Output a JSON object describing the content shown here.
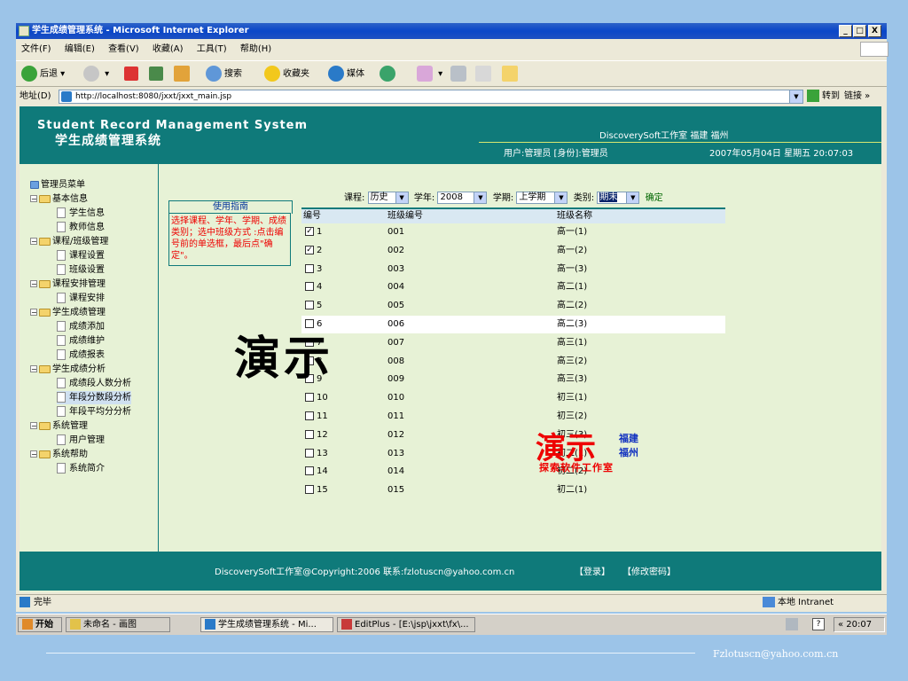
{
  "window": {
    "title": "学生成绩管理系统 - Microsoft Internet Explorer",
    "buttons": {
      "min": "_",
      "max": "□",
      "close": "X"
    }
  },
  "menu": [
    "文件(F)",
    "编辑(E)",
    "查看(V)",
    "收藏(A)",
    "工具(T)",
    "帮助(H)"
  ],
  "toolbar": {
    "back": "后退",
    "search": "搜索",
    "favorites": "收藏夹",
    "media": "媒体"
  },
  "address": {
    "label": "地址(D)",
    "url": "http://localhost:8080/jxxt/jxxt_main.jsp",
    "go": "转到",
    "links": "链接"
  },
  "header": {
    "title_en": "Student Record Management System",
    "title_cn": "学生成绩管理系统",
    "studio": "DiscoverySoft工作室 福建 福州",
    "user": "用户:管理员 [身份]:管理员",
    "datetime": "2007年05月04日 星期五 20:07:03"
  },
  "sidebar": {
    "root": "管理员菜单",
    "items": [
      {
        "label": "基本信息",
        "type": "folder"
      },
      {
        "label": "学生信息",
        "type": "doc"
      },
      {
        "label": "教师信息",
        "type": "doc"
      },
      {
        "label": "课程/班级管理",
        "type": "folder"
      },
      {
        "label": "课程设置",
        "type": "doc"
      },
      {
        "label": "班级设置",
        "type": "doc"
      },
      {
        "label": "课程安排管理",
        "type": "folder"
      },
      {
        "label": "课程安排",
        "type": "doc"
      },
      {
        "label": "学生成绩管理",
        "type": "folder"
      },
      {
        "label": "成绩添加",
        "type": "doc"
      },
      {
        "label": "成绩维护",
        "type": "doc"
      },
      {
        "label": "成绩报表",
        "type": "doc"
      },
      {
        "label": "学生成绩分析",
        "type": "folder"
      },
      {
        "label": "成绩段人数分析",
        "type": "doc"
      },
      {
        "label": "年段分数段分析",
        "type": "doc"
      },
      {
        "label": "年段平均分分析",
        "type": "doc"
      },
      {
        "label": "系统管理",
        "type": "folder"
      },
      {
        "label": "用户管理",
        "type": "doc"
      },
      {
        "label": "系统帮助",
        "type": "folder"
      },
      {
        "label": "系统简介",
        "type": "doc"
      }
    ]
  },
  "guide": {
    "title": "使用指南",
    "text": "选择课程、学年、学期、成绩类别；选中班级方式 :点击编号前的单选框，最后点\"确定\"。"
  },
  "filters": {
    "course_label": "课程:",
    "course": "历史",
    "year_label": "学年:",
    "year": "2008",
    "term_label": "学期:",
    "term": "上学期",
    "type_label": "类别:",
    "type": "期末",
    "confirm": "确定"
  },
  "table": {
    "headers": [
      "编号",
      "班级编号",
      "班级名称"
    ],
    "rows": [
      {
        "no": "1",
        "code": "001",
        "name": "高一(1)",
        "checked": true
      },
      {
        "no": "2",
        "code": "002",
        "name": "高一(2)",
        "checked": true
      },
      {
        "no": "3",
        "code": "003",
        "name": "高一(3)",
        "checked": false
      },
      {
        "no": "4",
        "code": "004",
        "name": "高二(1)",
        "checked": false
      },
      {
        "no": "5",
        "code": "005",
        "name": "高二(2)",
        "checked": false
      },
      {
        "no": "6",
        "code": "006",
        "name": "高二(3)",
        "checked": false
      },
      {
        "no": "7",
        "code": "007",
        "name": "高三(1)",
        "checked": false
      },
      {
        "no": "8",
        "code": "008",
        "name": "高三(2)",
        "checked": false
      },
      {
        "no": "9",
        "code": "009",
        "name": "高三(3)",
        "checked": false
      },
      {
        "no": "10",
        "code": "010",
        "name": "初三(1)",
        "checked": false
      },
      {
        "no": "11",
        "code": "011",
        "name": "初三(2)",
        "checked": false
      },
      {
        "no": "12",
        "code": "012",
        "name": "初三(3)",
        "checked": false
      },
      {
        "no": "13",
        "code": "013",
        "name": "初二(1)",
        "checked": false
      },
      {
        "no": "14",
        "code": "014",
        "name": "初二(2)",
        "checked": false
      },
      {
        "no": "15",
        "code": "015",
        "name": "初二(1)",
        "checked": false
      }
    ]
  },
  "watermark": {
    "big": "演示",
    "small": "演示",
    "fj": "福建",
    "fz": "福州",
    "studio": "探索软件工作室"
  },
  "footer": {
    "copyright": "DiscoverySoft工作室@Copyright:2006 联系:fzlotuscn@yahoo.com.cn",
    "login": "【登录】",
    "change_pwd": "【修改密码】"
  },
  "status": {
    "text": "完毕",
    "zone": "本地 Intranet"
  },
  "taskbar": {
    "start": "开始",
    "tasks": [
      "未命名 - 画图",
      "学生成绩管理系统 - Mi...",
      "EditPlus - [E:\\jsp\\jxxt\\fx\\..."
    ],
    "time": "20:07"
  },
  "slide_footer": "Fzlotuscn@yahoo.com.cn",
  "colors": {
    "teal": "#0f7a7a",
    "content_bg": "#e7f2d6",
    "guide_text": "#ee0000"
  }
}
